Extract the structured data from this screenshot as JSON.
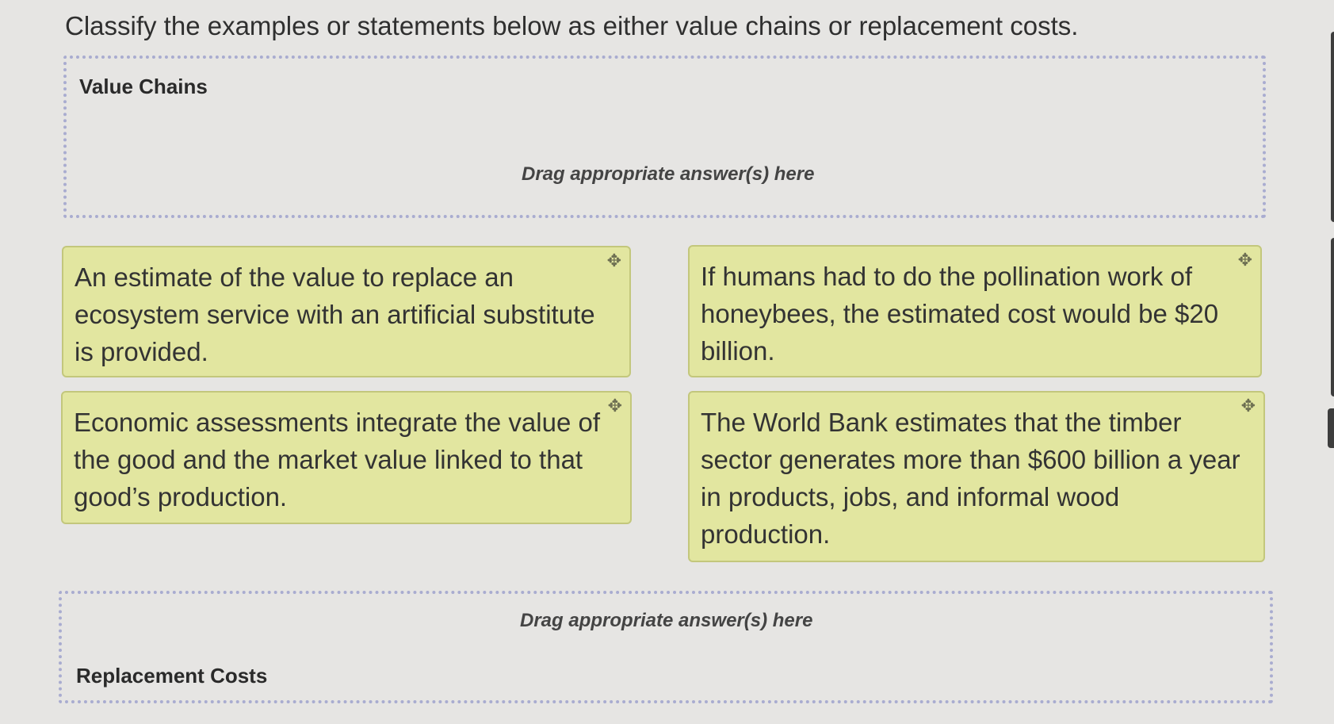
{
  "instruction": "Classify the examples or statements below as either value chains or replacement costs.",
  "zones": {
    "value_chains": {
      "title": "Value Chains",
      "hint": "Drag appropriate answer(s) here"
    },
    "replacement_costs": {
      "title": "Replacement Costs",
      "hint": "Drag appropriate answer(s) here"
    }
  },
  "cards": [
    {
      "text": "An estimate of the value to replace an ecosystem service with an artificial substitute is provided.",
      "icon": "move-icon"
    },
    {
      "text": "If humans had to do the pollination work of honeybees, the estimated cost would be $20 billion.",
      "icon": "move-icon"
    },
    {
      "text": "Economic assessments integrate the value of the good and the market value linked to that good’s production.",
      "icon": "move-icon"
    },
    {
      "text": "The World Bank estimates that the timber sector generates more than $600 billion a year in products, jobs, and informal wood production.",
      "icon": "move-icon"
    }
  ],
  "colors": {
    "card_bg": "#e2e6a0",
    "zone_border": "#a9acd0"
  }
}
